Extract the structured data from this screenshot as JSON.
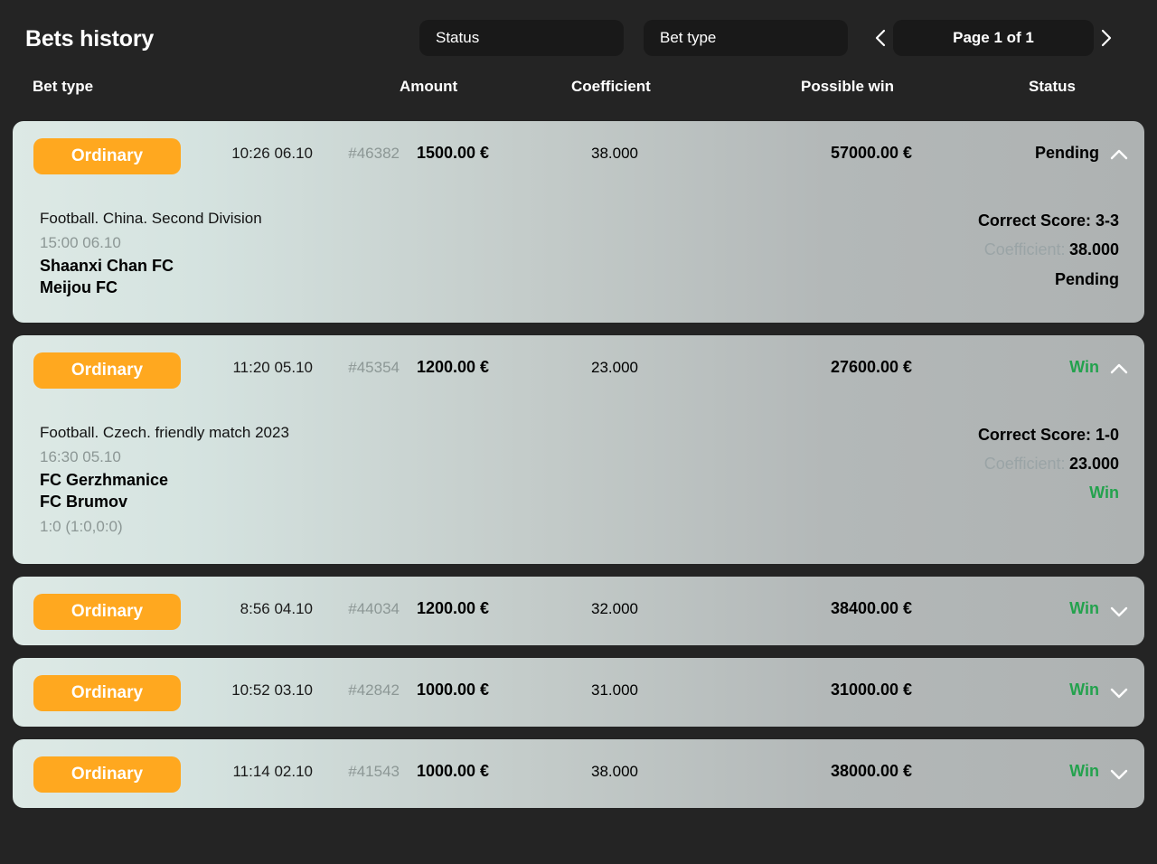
{
  "header": {
    "title": "Bets history",
    "status_filter": "Status",
    "bettype_filter": "Bet type",
    "prev_icon": "chevron-left-icon",
    "next_icon": "chevron-right-icon",
    "page_label": "Page 1 of 1"
  },
  "colors": {
    "accent_orange": "#ffa81f",
    "win_green": "#23a24d",
    "page_bg": "#242424",
    "card_left": "#dde9e5",
    "card_right": "#aeb2b2",
    "muted": "#8c9795"
  },
  "columns": {
    "bet_type": "Bet type",
    "amount": "Amount",
    "coefficient": "Coefficient",
    "possible_win": "Possible win",
    "status": "Status"
  },
  "bets": [
    {
      "type": "Ordinary",
      "datetime": "10:26 06.10",
      "id": "#46382",
      "amount": "1500.00 €",
      "coefficient": "38.000",
      "possible_win": "57000.00 €",
      "status": "Pending",
      "status_kind": "pending",
      "expanded": true,
      "chevron": "chevron-up-icon",
      "detail": {
        "league": "Football. China. Second Division",
        "time": "15:00 06.10",
        "team_home": "Shaanxi Chan FC",
        "team_away": "Meijou FC",
        "score": "",
        "pick": "Correct Score: 3-3",
        "coef_label": "Coefficient:",
        "coef_value": "38.000",
        "status": "Pending",
        "status_kind": "pending"
      }
    },
    {
      "type": "Ordinary",
      "datetime": "11:20 05.10",
      "id": "#45354",
      "amount": "1200.00 €",
      "coefficient": "23.000",
      "possible_win": "27600.00 €",
      "status": "Win",
      "status_kind": "win",
      "expanded": true,
      "chevron": "chevron-up-icon",
      "detail": {
        "league": "Football. Czech. friendly match 2023",
        "time": "16:30 05.10",
        "team_home": "FC Gerzhmanice",
        "team_away": "FC Brumov",
        "score": "1:0 (1:0,0:0)",
        "pick": "Correct Score: 1-0",
        "coef_label": "Coefficient:",
        "coef_value": "23.000",
        "status": "Win",
        "status_kind": "win"
      }
    },
    {
      "type": "Ordinary",
      "datetime": "8:56 04.10",
      "id": "#44034",
      "amount": "1200.00 €",
      "coefficient": "32.000",
      "possible_win": "38400.00 €",
      "status": "Win",
      "status_kind": "win",
      "expanded": false,
      "chevron": "chevron-down-icon"
    },
    {
      "type": "Ordinary",
      "datetime": "10:52 03.10",
      "id": "#42842",
      "amount": "1000.00 €",
      "coefficient": "31.000",
      "possible_win": "31000.00 €",
      "status": "Win",
      "status_kind": "win",
      "expanded": false,
      "chevron": "chevron-down-icon"
    },
    {
      "type": "Ordinary",
      "datetime": "11:14 02.10",
      "id": "#41543",
      "amount": "1000.00 €",
      "coefficient": "38.000",
      "possible_win": "38000.00 €",
      "status": "Win",
      "status_kind": "win",
      "expanded": false,
      "chevron": "chevron-down-icon"
    }
  ]
}
